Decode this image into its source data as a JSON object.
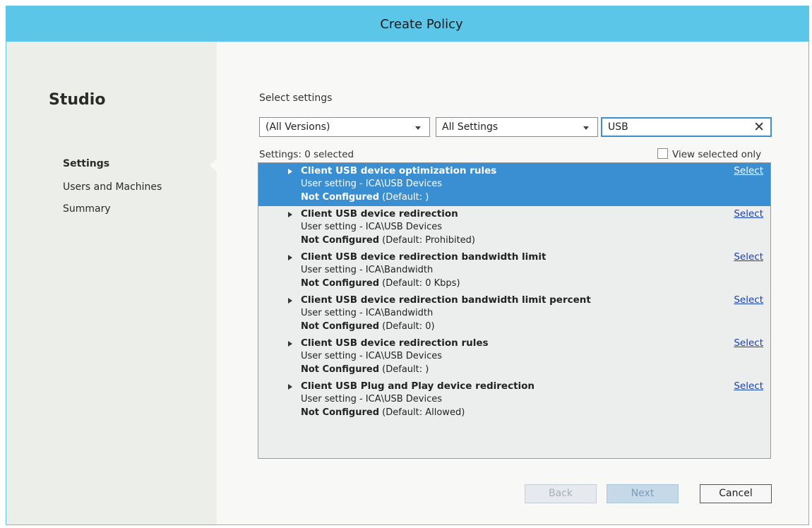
{
  "window": {
    "title": "Create Policy"
  },
  "sidebar": {
    "brand": "Studio",
    "items": [
      {
        "label": "Settings",
        "active": true
      },
      {
        "label": "Users and Machines",
        "active": false
      },
      {
        "label": "Summary",
        "active": false
      }
    ]
  },
  "main": {
    "heading": "Select settings",
    "version_filter": {
      "value": "(All Versions)"
    },
    "category_filter": {
      "value": "All Settings"
    },
    "search": {
      "value": "USB"
    },
    "count_label": "Settings: 0 selected",
    "view_selected_label": "View selected only",
    "view_selected_checked": false,
    "settings": [
      {
        "name": "Client USB device optimization rules",
        "scope": "User setting - ICA\\USB Devices",
        "status": "Not Configured",
        "default": "(Default: )",
        "action": "Select",
        "selected": true
      },
      {
        "name": "Client USB device redirection",
        "scope": "User setting - ICA\\USB Devices",
        "status": "Not Configured",
        "default": "(Default: Prohibited)",
        "action": "Select",
        "selected": false
      },
      {
        "name": "Client USB device redirection bandwidth limit",
        "scope": "User setting - ICA\\Bandwidth",
        "status": "Not Configured",
        "default": "(Default: 0 Kbps)",
        "action": "Select",
        "selected": false
      },
      {
        "name": "Client USB device redirection bandwidth limit percent",
        "scope": "User setting - ICA\\Bandwidth",
        "status": "Not Configured",
        "default": "(Default: 0)",
        "action": "Select",
        "selected": false
      },
      {
        "name": "Client USB device redirection rules",
        "scope": "User setting - ICA\\USB Devices",
        "status": "Not Configured",
        "default": "(Default: )",
        "action": "Select",
        "selected": false
      },
      {
        "name": "Client USB Plug and Play device redirection",
        "scope": "User setting - ICA\\USB Devices",
        "status": "Not Configured",
        "default": "(Default: Allowed)",
        "action": "Select",
        "selected": false
      }
    ]
  },
  "footer": {
    "back_label": "Back",
    "next_label": "Next",
    "cancel_label": "Cancel"
  },
  "colors": {
    "title_bar": "#5bc6e8",
    "selection": "#3a8ed2",
    "link": "#1a3fb0"
  },
  "icons": {
    "clear": "close-icon",
    "dropdown": "chevron-down-icon",
    "expand": "expand-triangle-icon"
  }
}
